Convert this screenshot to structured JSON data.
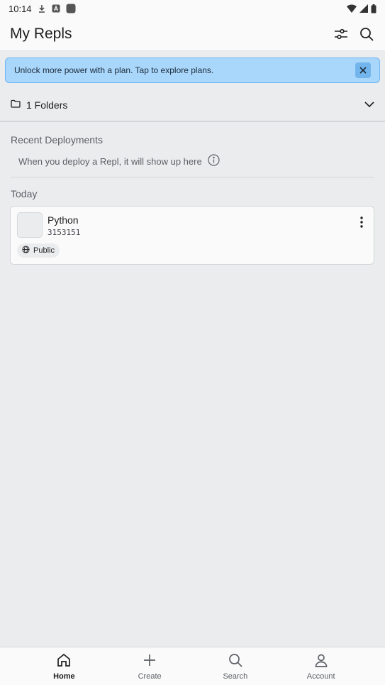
{
  "status_bar": {
    "time": "10:14",
    "icons": [
      "download-icon",
      "a-badge-icon",
      "app-square-icon",
      "wifi-icon",
      "signal-icon",
      "battery-icon"
    ]
  },
  "header": {
    "title": "My Repls",
    "actions": [
      "filter-icon",
      "search-icon"
    ]
  },
  "banner": {
    "text": "Unlock more power with a plan. Tap to explore plans.",
    "close_icon": "close-icon"
  },
  "folders": {
    "label": "1 Folders",
    "icon": "folder-icon",
    "chevron": "chevron-down-icon"
  },
  "recent_deployments": {
    "heading": "Recent Deployments",
    "empty_text": "When you deploy a Repl, it will show up here",
    "info_icon": "info-icon"
  },
  "today": {
    "heading": "Today",
    "repls": [
      {
        "name": "Python",
        "id": "3153151",
        "visibility": "Public",
        "visibility_icon": "globe-icon"
      }
    ]
  },
  "bottom_nav": {
    "items": [
      {
        "label": "Home",
        "icon": "home-icon",
        "active": true
      },
      {
        "label": "Create",
        "icon": "plus-icon",
        "active": false
      },
      {
        "label": "Search",
        "icon": "search-icon",
        "active": false
      },
      {
        "label": "Account",
        "icon": "user-icon",
        "active": false
      }
    ]
  },
  "colors": {
    "banner_bg": "#a9d6fb",
    "banner_border": "#6fb6f2",
    "page_bg": "#ebecee",
    "surface": "#fafafa"
  }
}
